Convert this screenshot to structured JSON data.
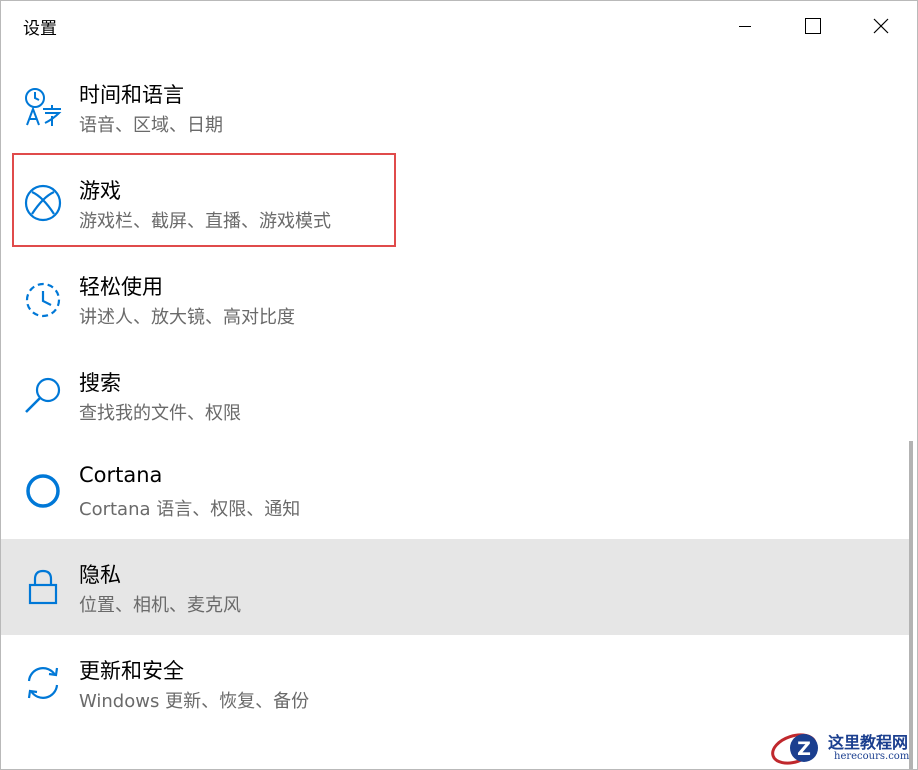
{
  "window": {
    "title": "设置"
  },
  "items": [
    {
      "title": "时间和语言",
      "desc": "语音、区域、日期",
      "icon": "time-language-icon"
    },
    {
      "title": "游戏",
      "desc": "游戏栏、截屏、直播、游戏模式",
      "icon": "xbox-icon"
    },
    {
      "title": "轻松使用",
      "desc": "讲述人、放大镜、高对比度",
      "icon": "ease-of-access-icon"
    },
    {
      "title": "搜索",
      "desc": "查找我的文件、权限",
      "icon": "search-icon"
    },
    {
      "title": "Cortana",
      "desc": "Cortana 语言、权限、通知",
      "icon": "cortana-icon"
    },
    {
      "title": "隐私",
      "desc": "位置、相机、麦克风",
      "icon": "lock-icon"
    },
    {
      "title": "更新和安全",
      "desc": "Windows 更新、恢复、备份",
      "icon": "update-icon"
    }
  ],
  "watermark": {
    "text": "这里教程网",
    "sub": "herecours.com"
  },
  "colors": {
    "accent": "#0078d7",
    "highlight": "#e04b4b",
    "hover_bg": "#e6e6e6"
  }
}
